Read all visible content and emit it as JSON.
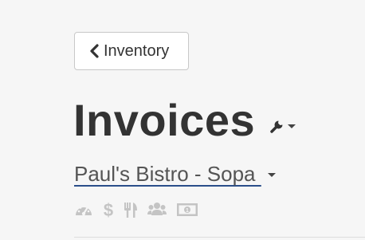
{
  "header": {
    "back_button_label": "Inventory",
    "page_title": "Invoices",
    "tools_icon": "wrench-icon"
  },
  "restaurant": {
    "name": "Paul's Bistro - Sopa "
  },
  "nav_icons": [
    {
      "name": "dashboard-icon"
    },
    {
      "name": "dollar-icon"
    },
    {
      "name": "fork-knife-icon"
    },
    {
      "name": "users-icon"
    },
    {
      "name": "money-bill-icon"
    }
  ],
  "colors": {
    "background": "#f6f6f6",
    "title": "#333333",
    "underline": "#2a4e8a",
    "icon_muted": "#c4c4c4"
  }
}
